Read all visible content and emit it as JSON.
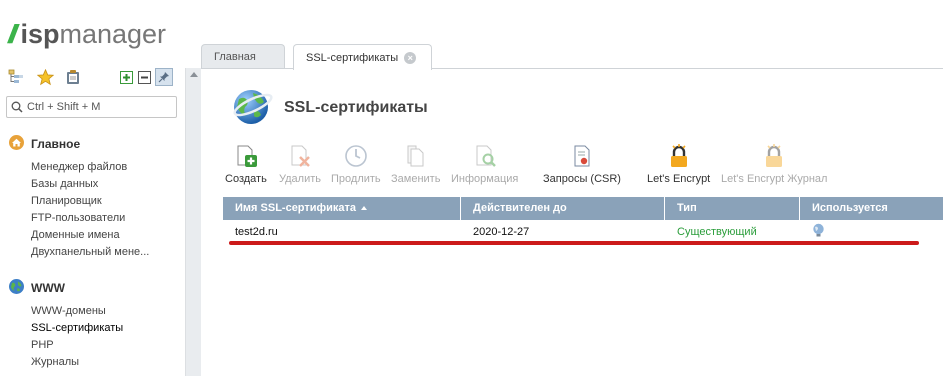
{
  "app": {
    "logo_slash": "//",
    "logo_isp": "isp",
    "logo_manager": "manager"
  },
  "quicktools": {
    "tree_icon": "tree-view-icon",
    "favorites_icon": "star-icon",
    "clipboard_icon": "clipboard-icon",
    "expand_icon": "plus-box-icon",
    "collapse_icon": "minus-box-icon",
    "pin_icon": "pin-icon"
  },
  "search": {
    "placeholder": "Ctrl + Shift + M"
  },
  "menu": [
    {
      "title": "Главное",
      "icon": "home-icon",
      "items": [
        "Менеджер файлов",
        "Базы данных",
        "Планировщик",
        "FTP-пользователи",
        "Доменные имена",
        "Двухпанельный мене..."
      ]
    },
    {
      "title": "WWW",
      "icon": "globe-icon",
      "items": [
        "WWW-домены",
        "SSL-сертификаты",
        "PHP",
        "Журналы"
      ]
    }
  ],
  "tabs": [
    {
      "label": "Главная",
      "active": false
    },
    {
      "label": "SSL-сертификаты",
      "active": true
    }
  ],
  "page": {
    "title": "SSL-сертификаты"
  },
  "toolbar": [
    {
      "label": "Создать",
      "enabled": true
    },
    {
      "label": "Удалить",
      "enabled": false
    },
    {
      "label": "Продлить",
      "enabled": false
    },
    {
      "label": "Заменить",
      "enabled": false
    },
    {
      "label": "Информация",
      "enabled": false
    },
    {
      "label": "Запросы (CSR)",
      "enabled": true
    },
    {
      "label": "Let's Encrypt",
      "enabled": true
    },
    {
      "label": "Let's Encrypt Журнал",
      "enabled": false
    }
  ],
  "table": {
    "columns": [
      "Имя SSL-сертификата",
      "Действителен до",
      "Тип",
      "Используется"
    ],
    "rows": [
      {
        "name": "test2d.ru",
        "valid_until": "2020-12-27",
        "type": "Существующий",
        "used": "globe-icon"
      }
    ]
  },
  "colors": {
    "accent_green": "#3bb34a",
    "header_blue": "#8aa2b9",
    "type_green": "#2a9d3a",
    "highlight_red": "#cc1a1a"
  }
}
